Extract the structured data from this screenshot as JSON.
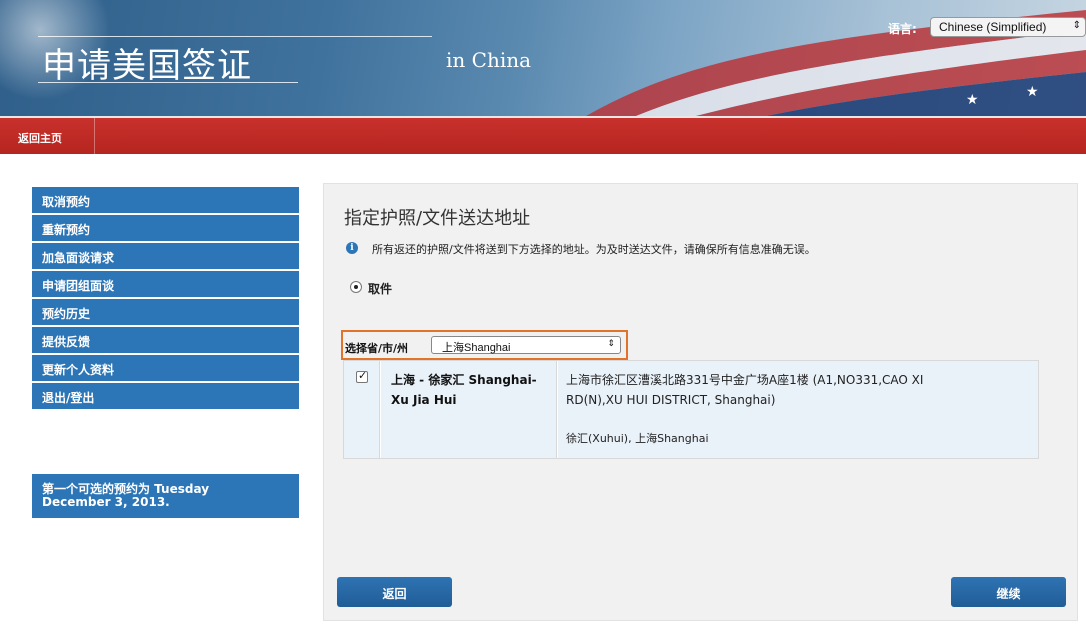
{
  "header": {
    "title": "申请美国签证",
    "subtitle": "in China",
    "language_label": "语言:",
    "language_value": "Chinese (Simplified)"
  },
  "nav": {
    "home": "返回主页"
  },
  "sidebar": {
    "items": [
      {
        "label": "取消预约"
      },
      {
        "label": "重新预约"
      },
      {
        "label": "加急面谈请求"
      },
      {
        "label": "申请团组面谈"
      },
      {
        "label": "预约历史"
      },
      {
        "label": "提供反馈"
      },
      {
        "label": "更新个人资料"
      },
      {
        "label": "退出/登出"
      }
    ],
    "notice_line1": "第一个可选的预约为 Tuesday",
    "notice_line2": "December 3, 2013."
  },
  "main": {
    "title": "指定护照/文件送达地址",
    "info": "所有返还的护照/文件将送到下方选择的地址。为及时送达文件，请确保所有信息准确无误。",
    "option_label": "取件",
    "province_label": "选择省/市/州",
    "province_value": "上海Shanghai",
    "location": {
      "name_line1": "上海 - 徐家汇 Shanghai-",
      "name_line2": "Xu Jia Hui",
      "address_line1": "上海市徐汇区漕溪北路331号中金广场A座1楼  (A1,NO331,CAO XI",
      "address_line2": "RD(N),XU HUI DISTRICT, Shanghai)",
      "address_line3": "徐汇(Xuhui), 上海Shanghai",
      "checked": true
    },
    "back_button": "返回",
    "continue_button": "继续"
  },
  "colors": {
    "nav_red": "#c8312d",
    "sidebar_blue": "#2c76b8",
    "highlight_orange": "#e2732a"
  }
}
